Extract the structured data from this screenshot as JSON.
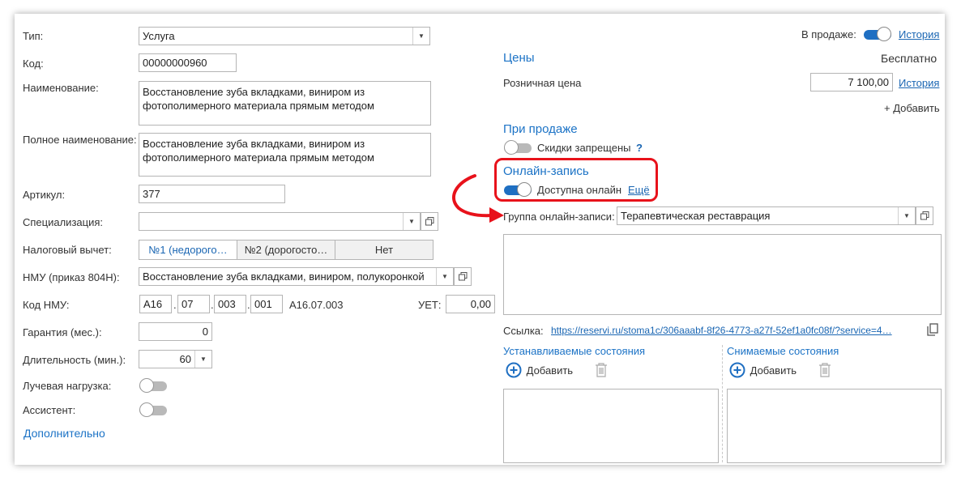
{
  "left": {
    "type_label": "Тип:",
    "type_value": "Услуга",
    "code_label": "Код:",
    "code_value": "00000000960",
    "name_label": "Наименование:",
    "name_value": "Восстановление зуба вкладками, виниром из фотополимерного материала прямым методом",
    "fullname_label": "Полное наименование:",
    "fullname_value": "Восстановление зуба вкладками, виниром из фотополимерного материала прямым методом",
    "article_label": "Артикул:",
    "article_value": "377",
    "spec_label": "Специализация:",
    "spec_value": "",
    "tax_label": "Налоговый вычет:",
    "tax_options": [
      "№1 (недорого…",
      "№2 (дорогосто…",
      "Нет"
    ],
    "nmu_label": "НМУ (приказ 804Н):",
    "nmu_value": "Восстановление зуба вкладками, виниром, полукоронкой",
    "nmu_code_label": "Код НМУ:",
    "nmu_code_parts": [
      "A16",
      "07",
      "003",
      "001"
    ],
    "nmu_code_full": "A16.07.003",
    "uet_label": "УЕТ:",
    "uet_value": "0,00",
    "warranty_label": "Гарантия (мес.):",
    "warranty_value": "0",
    "duration_label": "Длительность (мин.):",
    "duration_value": "60",
    "radiation_label": "Лучевая нагрузка:",
    "assistant_label": "Ассистент:",
    "more_label": "Дополнительно"
  },
  "right": {
    "on_sale_label": "В продаже:",
    "history_link": "История",
    "prices_header": "Цены",
    "free_label": "Бесплатно",
    "retail_label": "Розничная цена",
    "retail_value": "7 100,00",
    "retail_history_link": "История",
    "add_price": "+ Добавить",
    "on_sale_header": "При продаже",
    "discounts_label": "Скидки запрещены",
    "help_mark": "?",
    "online_header": "Онлайн-запись",
    "online_available_label": "Доступна онлайн",
    "more_link": "Ещё",
    "group_label": "Группа онлайн-записи:",
    "group_value": "Терапевтическая реставрация",
    "link_label": "Ссылка:",
    "link_value": "https://reservi.ru/stoma1c/306aaabf-8f26-4773-a27f-52ef1a0fc08f/?service=4…",
    "set_states_header": "Устанавливаемые состояния",
    "removed_states_header": "Снимаемые состояния",
    "add_label": "Добавить",
    "add_label2": "Добавить"
  },
  "toggles": {
    "on_sale": true,
    "discounts_forbidden": false,
    "online_available": true,
    "radiation": false,
    "assistant": false
  },
  "colors": {
    "accent": "#1f6fc2",
    "section": "#1c73c6",
    "highlight": "#e8121b"
  }
}
